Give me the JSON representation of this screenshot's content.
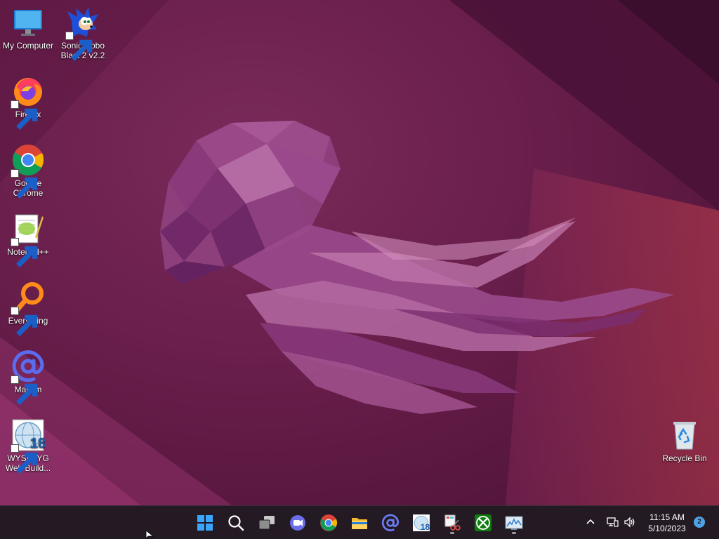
{
  "desktop": {
    "icons": [
      {
        "label": "My Computer",
        "icon": "monitor-icon"
      },
      {
        "label": "Sonic Robo Blast 2 v2.2",
        "icon": "sonic-icon"
      },
      {
        "label": "Firefox",
        "icon": "firefox-icon"
      },
      {
        "label": "Google Chrome",
        "icon": "chrome-icon"
      },
      {
        "label": "Notepad++",
        "icon": "notepad-plus-plus-icon"
      },
      {
        "label": "Everything",
        "icon": "everything-search-icon"
      },
      {
        "label": "Mail.tm",
        "icon": "mail-at-icon"
      },
      {
        "label": "WYSIWYG Web Build...",
        "icon": "wysiwyg-web-builder-icon"
      },
      {
        "label": "Recycle Bin",
        "icon": "recycle-bin-icon"
      }
    ]
  },
  "taskbar": {
    "items": [
      {
        "name": "start",
        "icon": "windows-start-icon"
      },
      {
        "name": "search",
        "icon": "search-icon"
      },
      {
        "name": "task-view",
        "icon": "task-view-icon"
      },
      {
        "name": "chat",
        "icon": "teams-chat-icon"
      },
      {
        "name": "chrome",
        "icon": "chrome-icon"
      },
      {
        "name": "file-explorer",
        "icon": "folder-icon"
      },
      {
        "name": "mail-tm",
        "icon": "mail-at-icon"
      },
      {
        "name": "wysiwyg-web-builder",
        "icon": "wysiwyg-web-builder-icon"
      },
      {
        "name": "snipping-tool",
        "icon": "snipping-tool-icon"
      },
      {
        "name": "xbox",
        "icon": "xbox-icon"
      },
      {
        "name": "resource-monitor",
        "icon": "resource-monitor-icon"
      }
    ],
    "tray": {
      "icons": [
        "chevron-up-icon",
        "network-icon",
        "volume-icon"
      ],
      "time": "11:15 AM",
      "date": "5/10/2023",
      "notification_count": "2"
    }
  },
  "colors": {
    "taskbar_bg": "#231a23",
    "wallpaper_base": "#6a1f4c",
    "jellyfish": "#a0508f",
    "notification_badge": "#4ea3e8"
  }
}
